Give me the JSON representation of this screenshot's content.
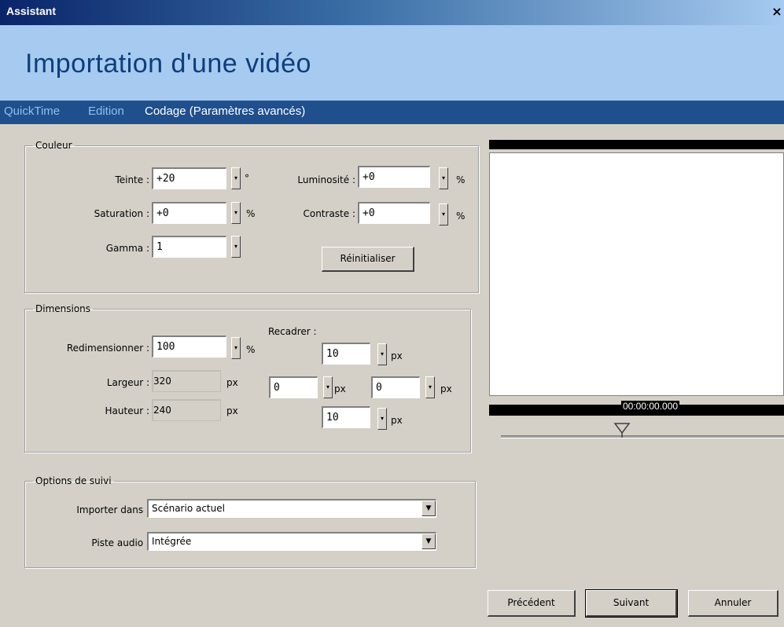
{
  "window": {
    "title": "Assistant",
    "close": "×"
  },
  "header": {
    "heading": "Importation d'une vidéo"
  },
  "nav": {
    "tabs": [
      "QuickTime",
      "Edition",
      "Codage (Paramètres avancés)"
    ]
  },
  "couleur": {
    "legend": "Couleur",
    "teinte": {
      "label": "Teinte :",
      "value": "+20",
      "unit": "°"
    },
    "saturation": {
      "label": "Saturation :",
      "value": "+0",
      "unit": "%"
    },
    "gamma": {
      "label": "Gamma :",
      "value": "1"
    },
    "luminosite": {
      "label": "Luminosité :",
      "value": "+0",
      "unit": "%"
    },
    "contraste": {
      "label": "Contraste :",
      "value": "+0",
      "unit": "%"
    },
    "reset": "Réinitialiser"
  },
  "dimensions": {
    "legend": "Dimensions",
    "redim": {
      "label": "Redimensionner :",
      "value": "100",
      "unit": "%"
    },
    "largeur": {
      "label": "Largeur :",
      "value": "320",
      "unit": "px"
    },
    "hauteur": {
      "label": "Hauteur :",
      "value": "240",
      "unit": "px"
    },
    "recadrer": {
      "label": "Recadrer :",
      "top": "10",
      "left": "0",
      "right": "0",
      "bottom": "10",
      "unit": "px"
    }
  },
  "suivi": {
    "legend": "Options de suivi",
    "importer": {
      "label": "Importer dans :",
      "value": "Scénario actuel"
    },
    "piste": {
      "label": "Piste audio :",
      "value": "Intégrée"
    }
  },
  "preview": {
    "timecode": "00:00:00.000"
  },
  "footer": {
    "prev": "Précédent",
    "next": "Suivant",
    "cancel": "Annuler"
  }
}
